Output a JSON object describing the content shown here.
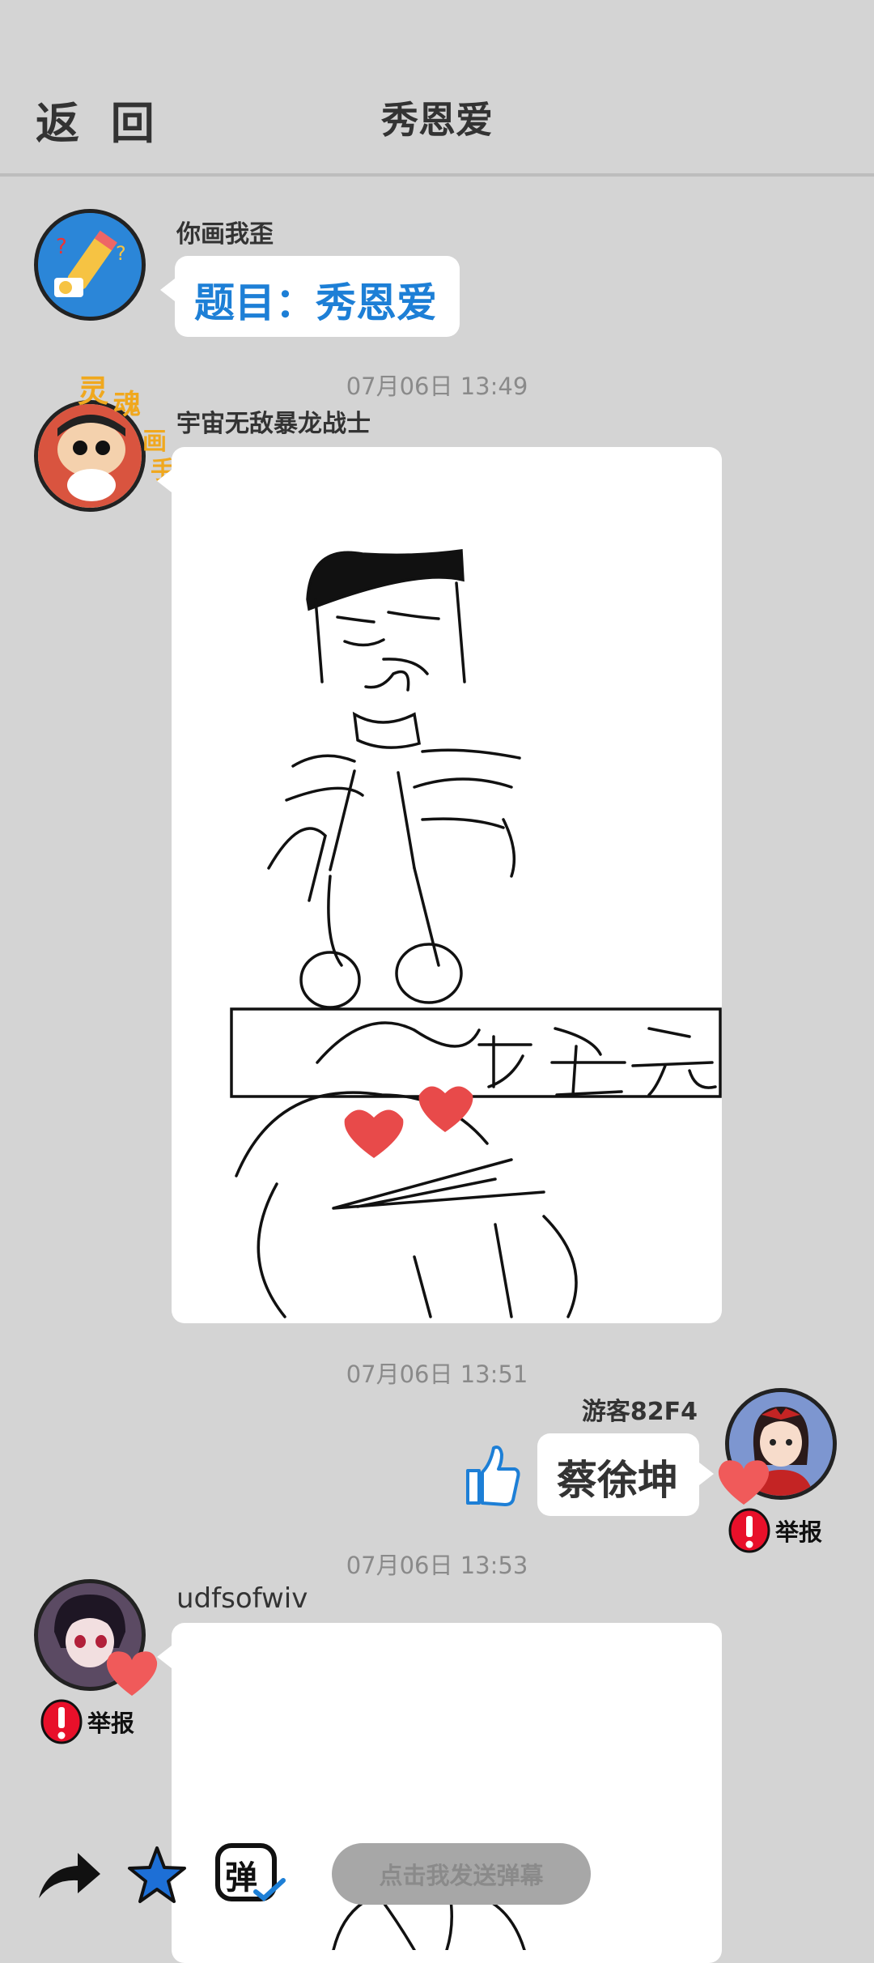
{
  "header": {
    "back_label": "返 回",
    "title": "秀恩爱"
  },
  "messages": [
    {
      "user": "你画我歪",
      "topic": "题目：秀恩爱"
    },
    {
      "time": "07月06日  13:49",
      "user": "宇宙无敌暴龙战士",
      "badge": "灵魂画手",
      "drawing_text": "破壳"
    },
    {
      "time": "07月06日  13:51",
      "user": "游客82F4",
      "guess": "蔡徐坤",
      "report_label": "举报"
    },
    {
      "time": "07月06日  13:53",
      "user": "udfsofwiv",
      "report_label": "举报"
    }
  ],
  "toolbar": {
    "share_icon": "share-arrow-icon",
    "star_icon": "star-icon",
    "danmu_icon_label": "弹",
    "danmu_placeholder": "点击我发送弹幕"
  },
  "colors": {
    "accent": "#1d7fd6",
    "heart": "#f05a5a",
    "report": "#e8102a",
    "bg": "#d4d4d4"
  }
}
